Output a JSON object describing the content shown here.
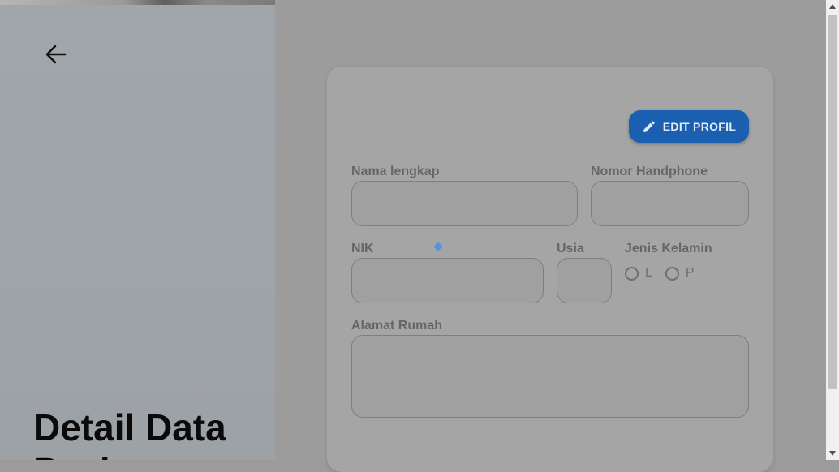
{
  "page": {
    "title": "Detail Data Pasien"
  },
  "header": {
    "back_icon": "arrow-left-icon"
  },
  "toolbar": {
    "edit_label": "EDIT PROFIL",
    "edit_icon": "pencil-icon",
    "accent": "#1a5fb0"
  },
  "form": {
    "full_name": {
      "label": "Nama lengkap",
      "value": ""
    },
    "phone": {
      "label": "Nomor Handphone",
      "value": ""
    },
    "nik": {
      "label": "NIK",
      "value": ""
    },
    "age": {
      "label": "Usia",
      "value": ""
    },
    "gender": {
      "label": "Jenis Kelamin",
      "options": [
        "L",
        "P"
      ],
      "selected": null
    },
    "address": {
      "label": "Alamat Rumah",
      "value": ""
    }
  }
}
